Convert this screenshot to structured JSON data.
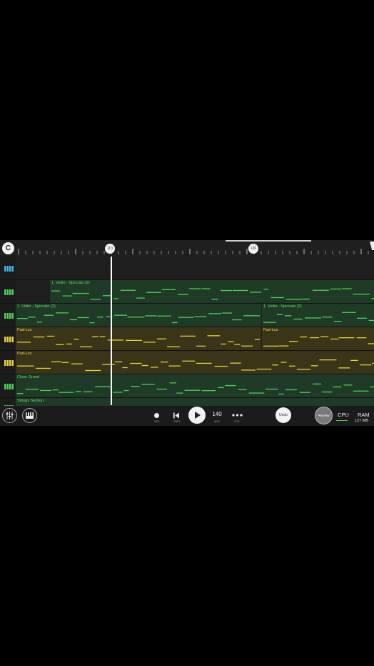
{
  "app": {
    "logo_glyph": "C"
  },
  "timeline": {
    "markers": [
      "113",
      "126"
    ],
    "tick_color": "#888888"
  },
  "tracks": [
    {
      "icon": "blue-instrument-icon",
      "color": "#3fb6e8",
      "clips": []
    },
    {
      "icon": "green-instrument-icon",
      "color": "#4ccf5a",
      "clips": [
        {
          "label": "1. Violin - Spiccato (2)"
        }
      ]
    },
    {
      "icon": "green-instrument-icon",
      "color": "#4ccf5a",
      "clips": [
        {
          "label": "1. Violin - Spiccato (2)"
        },
        {
          "label": "1. Violin - Spiccato (2)"
        }
      ]
    },
    {
      "icon": "yellow-instrument-icon",
      "color": "#e2d33a",
      "clips": [
        {
          "label": "Pad-Loz"
        },
        {
          "label": "Pad-Loz"
        }
      ]
    },
    {
      "icon": "yellow-instrument-icon",
      "color": "#e2d33a",
      "clips": [
        {
          "label": "Pad-Loz"
        }
      ]
    },
    {
      "icon": "green-instrument-icon",
      "color": "#4ccf5a",
      "clips": [
        {
          "label": "Close Grand"
        }
      ]
    },
    {
      "icon": "green-instrument-icon",
      "color": "#4ccf5a",
      "clips": [
        {
          "label": "Strings Section"
        }
      ]
    }
  ],
  "transport": {
    "rec_label": "REC",
    "prev_label": "PREV",
    "tempo": "140",
    "tempo_label": "BPM",
    "more_label": "OTR",
    "undo_label": "Undo",
    "preview_label": "Preview",
    "cpu_label": "CPU",
    "ram_label": "RAM",
    "ram_value": "127 MB"
  }
}
